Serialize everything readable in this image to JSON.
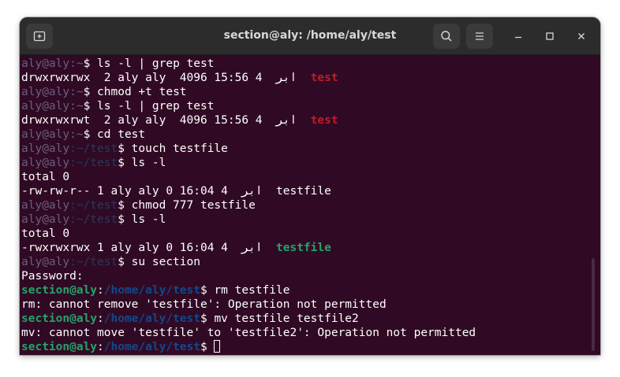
{
  "window": {
    "title": "section@aly: /home/aly/test"
  },
  "icons": {
    "new_tab": "new-tab-icon",
    "search": "search-icon",
    "menu": "hamburger-menu-icon",
    "minimize": "minimize-icon",
    "maximize": "maximize-icon",
    "close": "close-icon"
  },
  "colors": {
    "terminal_bg": "#300a24",
    "titlebar_bg": "#2c2c2c",
    "faded_user": "#6c5d7e",
    "faded_path": "#28385f",
    "prompt_green": "#26a269",
    "prompt_blue": "#12488b",
    "dir_red": "#c01c28",
    "exec_green": "#26a269"
  },
  "terminal": {
    "lines": [
      [
        {
          "t": "aly@aly",
          "c": "c-user"
        },
        {
          "t": ":~",
          "c": "c-user"
        },
        {
          "t": "$ ls -l | grep test"
        }
      ],
      [
        {
          "t": "drwxrwxrwx  2 aly aly  4096 15:56 4  ابر  "
        },
        {
          "t": "test",
          "c": "c-red"
        }
      ],
      [
        {
          "t": "aly@aly",
          "c": "c-user"
        },
        {
          "t": ":~",
          "c": "c-user"
        },
        {
          "t": "$ chmod +t test"
        }
      ],
      [
        {
          "t": "aly@aly",
          "c": "c-user"
        },
        {
          "t": ":~",
          "c": "c-user"
        },
        {
          "t": "$ ls -l | grep test"
        }
      ],
      [
        {
          "t": "drwxrwxrwt  2 aly aly  4096 15:56 4  ابر  "
        },
        {
          "t": "test",
          "c": "c-red"
        }
      ],
      [
        {
          "t": "aly@aly",
          "c": "c-user"
        },
        {
          "t": ":~",
          "c": "c-user"
        },
        {
          "t": "$ cd test"
        }
      ],
      [
        {
          "t": "aly@aly",
          "c": "c-user"
        },
        {
          "t": ":~/test",
          "c": "c-path"
        },
        {
          "t": "$ touch testfile"
        }
      ],
      [
        {
          "t": "aly@aly",
          "c": "c-user"
        },
        {
          "t": ":~/test",
          "c": "c-path"
        },
        {
          "t": "$ ls -l"
        }
      ],
      [
        {
          "t": "total 0"
        }
      ],
      [
        {
          "t": "-rw-rw-r-- 1 aly aly 0 16:04 4  ابر  testfile"
        }
      ],
      [
        {
          "t": "aly@aly",
          "c": "c-user"
        },
        {
          "t": ":~/test",
          "c": "c-path"
        },
        {
          "t": "$ chmod 777 testfile"
        }
      ],
      [
        {
          "t": "aly@aly",
          "c": "c-user"
        },
        {
          "t": ":~/test",
          "c": "c-path"
        },
        {
          "t": "$ ls -l"
        }
      ],
      [
        {
          "t": "total 0"
        }
      ],
      [
        {
          "t": "-rwxrwxrwx 1 aly aly 0 16:04 4  ابر  "
        },
        {
          "t": "testfile",
          "c": "c-grn"
        }
      ],
      [
        {
          "t": "aly@aly",
          "c": "c-user"
        },
        {
          "t": ":~/test",
          "c": "c-path"
        },
        {
          "t": "$ su section"
        }
      ],
      [
        {
          "t": "Password:"
        }
      ],
      [
        {
          "t": "section@aly",
          "c": "c-gb"
        },
        {
          "t": ":"
        },
        {
          "t": "/home/aly/test",
          "c": "c-bb"
        },
        {
          "t": "$ rm testfile"
        }
      ],
      [
        {
          "t": "rm: cannot remove 'testfile': Operation not permitted"
        }
      ],
      [
        {
          "t": "section@aly",
          "c": "c-gb"
        },
        {
          "t": ":"
        },
        {
          "t": "/home/aly/test",
          "c": "c-bb"
        },
        {
          "t": "$ mv testfile testfile2"
        }
      ],
      [
        {
          "t": "mv: cannot move 'testfile' to 'testfile2': Operation not permitted"
        }
      ],
      [
        {
          "t": "section@aly",
          "c": "c-gb"
        },
        {
          "t": ":"
        },
        {
          "t": "/home/aly/test",
          "c": "c-bb"
        },
        {
          "t": "$ "
        },
        {
          "cursor": true
        }
      ]
    ]
  }
}
